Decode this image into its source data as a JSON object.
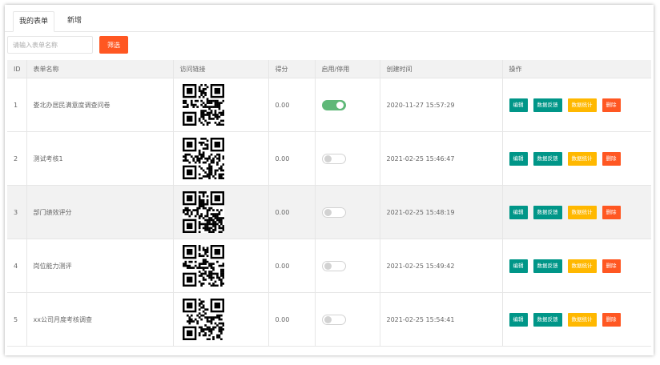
{
  "tabs": [
    {
      "label": "我的表单",
      "active": true
    },
    {
      "label": "新增",
      "active": false
    }
  ],
  "search": {
    "placeholder": "请输入表单名称",
    "value": ""
  },
  "filter_button": {
    "label": "筛选",
    "color": "#ff5722"
  },
  "table": {
    "columns": [
      "ID",
      "表单名称",
      "访问链接",
      "得分",
      "启用/停用",
      "创建时间",
      "操作"
    ],
    "rows": [
      {
        "id": "1",
        "name": "娄北办居民满意度调查问卷",
        "score": "0.00",
        "enabled": true,
        "created": "2020-11-27 15:57:29"
      },
      {
        "id": "2",
        "name": "测试考核1",
        "score": "0.00",
        "enabled": false,
        "created": "2021-02-25 15:46:47"
      },
      {
        "id": "3",
        "name": "部门绩效评分",
        "score": "0.00",
        "enabled": false,
        "created": "2021-02-25 15:48:19"
      },
      {
        "id": "4",
        "name": "岗位能力测评",
        "score": "0.00",
        "enabled": false,
        "created": "2021-02-25 15:49:42"
      },
      {
        "id": "5",
        "name": "xx公司月度考核调查",
        "score": "0.00",
        "enabled": false,
        "created": "2021-02-25 15:54:41"
      }
    ]
  },
  "actions": {
    "edit": "编辑",
    "feedback": "数据反馈",
    "stats": "数据统计",
    "delete": "删除"
  },
  "colors": {
    "accent_teal": "#009688",
    "accent_yellow": "#ffb800",
    "accent_red": "#ff5722",
    "switch_on": "#5fb878"
  },
  "icons": {
    "link_cell": "qr-code-icon"
  }
}
